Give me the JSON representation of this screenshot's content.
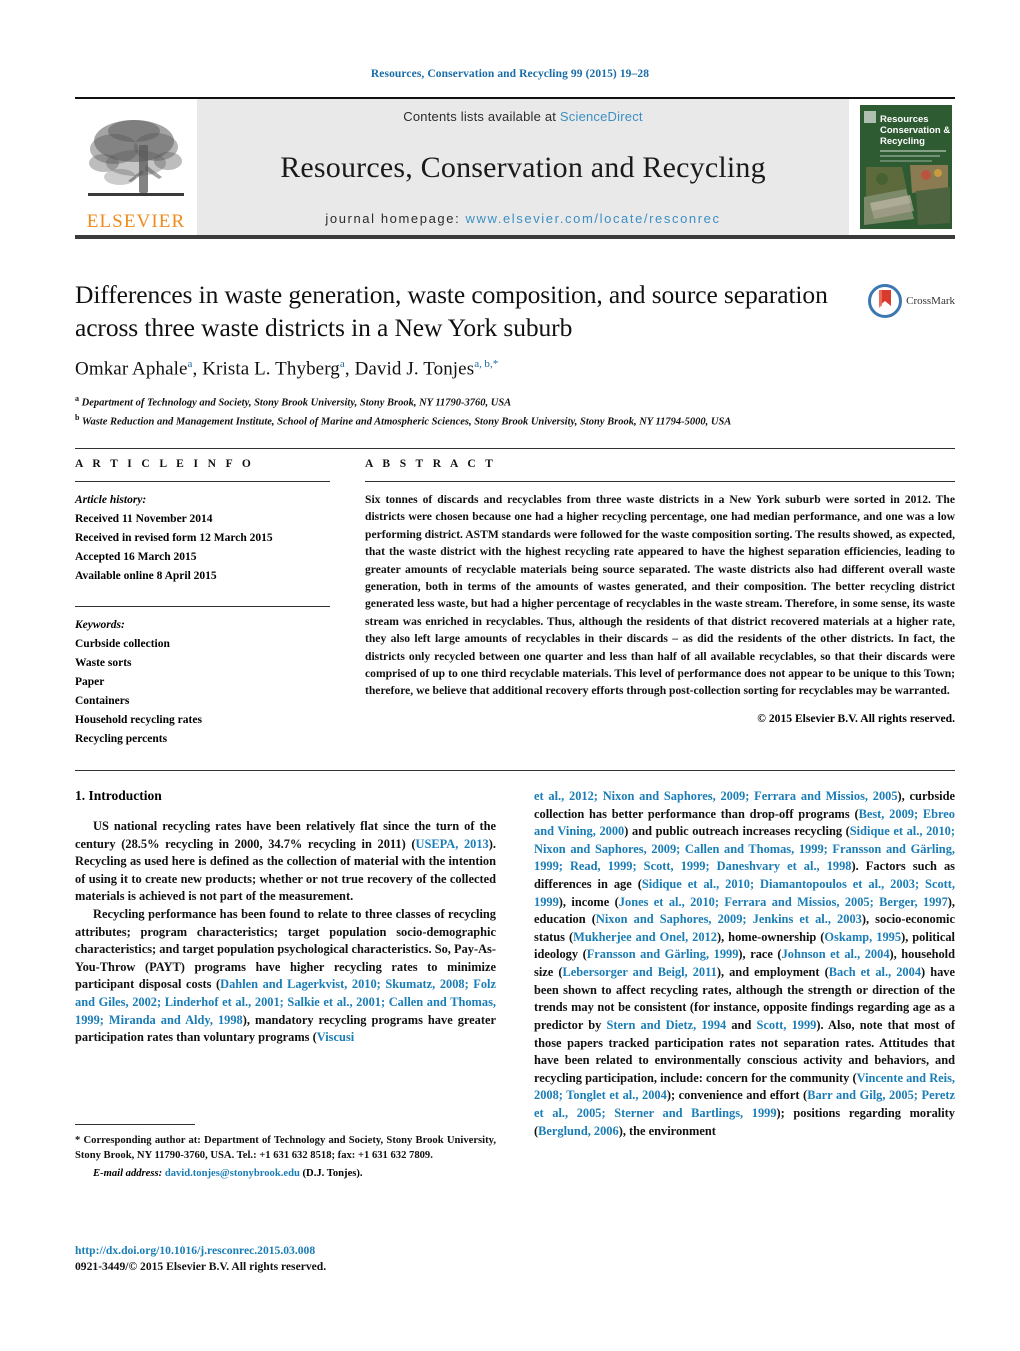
{
  "running_head": "Resources, Conservation and Recycling 99 (2015) 19–28",
  "masthead": {
    "publisher_logo_text": "ELSEVIER",
    "contents_prefix": "Contents lists available at",
    "contents_link": "ScienceDirect",
    "journal_name": "Resources, Conservation and Recycling",
    "homepage_prefix": "journal homepage:",
    "homepage_url": "www.elsevier.com/locate/resconrec",
    "cover_title_line1": "Resources",
    "cover_title_line2": "Conservation &",
    "cover_title_line3": "Recycling",
    "link_color": "#3d8fc4"
  },
  "article": {
    "title": "Differences in waste generation, waste composition, and source separation across three waste districts in a New York suburb",
    "authors_html": "Omkar Aphale<sup>a</sup>, Krista L. Thyberg<sup>a</sup>, David J. Tonjes<sup>a, b,</sup><sup>*</sup>",
    "affiliation_a": "Department of Technology and Society, Stony Brook University, Stony Brook, NY 11790-3760, USA",
    "affiliation_b": "Waste Reduction and Management Institute, School of Marine and Atmospheric Sciences, Stony Brook University, Stony Brook, NY 11794-5000, USA",
    "crossmark_label": "CrossMark"
  },
  "article_info": {
    "heading": "A R T I C L E   I N F O",
    "history_label": "Article history:",
    "history": [
      "Received 11 November 2014",
      "Received in revised form 12 March 2015",
      "Accepted 16 March 2015",
      "Available online 8 April 2015"
    ],
    "keywords_label": "Keywords:",
    "keywords": [
      "Curbside collection",
      "Waste sorts",
      "Paper",
      "Containers",
      "Household recycling rates",
      "Recycling percents"
    ]
  },
  "abstract": {
    "heading": "A B S T R A C T",
    "text": "Six tonnes of discards and recyclables from three waste districts in a New York suburb were sorted in 2012. The districts were chosen because one had a higher recycling percentage, one had median performance, and one was a low performing district. ASTM standards were followed for the waste composition sorting. The results showed, as expected, that the waste district with the highest recycling rate appeared to have the highest separation efficiencies, leading to greater amounts of recyclable materials being source separated. The waste districts also had different overall waste generation, both in terms of the amounts of wastes generated, and their composition. The better recycling district generated less waste, but had a higher percentage of recyclables in the waste stream. Therefore, in some sense, its waste stream was enriched in recyclables. Thus, although the residents of that district recovered materials at a higher rate, they also left large amounts of recyclables in their discards – as did the residents of the other districts. In fact, the districts only recycled between one quarter and less than half of all available recyclables, so that their discards were comprised of up to one third recyclable materials. This level of performance does not appear to be unique to this Town; therefore, we believe that additional recovery efforts through post-collection sorting for recyclables may be warranted.",
    "copyright": "© 2015 Elsevier B.V. All rights reserved."
  },
  "introduction": {
    "heading": "1.  Introduction",
    "left_paragraphs": [
      {
        "segments": [
          {
            "t": "US national recycling rates have been relatively flat since the turn of the century (28.5% recycling in 2000, 34.7% recycling in 2011) (",
            "link": false
          },
          {
            "t": "USEPA, 2013",
            "link": true
          },
          {
            "t": "). Recycling as used here is defined as the collection of material with the intention of using it to create new products; whether or not true recovery of the collected materials is achieved is not part of the measurement.",
            "link": false
          }
        ]
      },
      {
        "segments": [
          {
            "t": "Recycling performance has been found to relate to three classes of recycling attributes; program characteristics; target population socio-demographic characteristics; and target population psychological characteristics. So, Pay-As-You-Throw (PAYT) programs have higher recycling rates to minimize participant disposal costs (",
            "link": false
          },
          {
            "t": "Dahlen and Lagerkvist, 2010; Skumatz, 2008; Folz and Giles, 2002; Linderhof et al., 2001; Salkie et al., 2001; Callen and Thomas, 1999; Miranda and Aldy, 1998",
            "link": true
          },
          {
            "t": "), mandatory recycling programs have greater participation rates than voluntary programs (",
            "link": false
          },
          {
            "t": "Viscusi",
            "link": true
          }
        ]
      }
    ],
    "right_paragraphs": [
      {
        "segments": [
          {
            "t": "et al., 2012; Nixon and Saphores, 2009; Ferrara and Missios, 2005",
            "link": true
          },
          {
            "t": "), curbside collection has better performance than drop-off programs (",
            "link": false
          },
          {
            "t": "Best, 2009; Ebreo and Vining, 2000",
            "link": true
          },
          {
            "t": ") and public outreach increases recycling (",
            "link": false
          },
          {
            "t": "Sidique et al., 2010; Nixon and Saphores, 2009; Callen and Thomas, 1999; Fransson and Gärling, 1999; Read, 1999; Scott, 1999; Daneshvary et al., 1998",
            "link": true
          },
          {
            "t": "). Factors such as differences in age (",
            "link": false
          },
          {
            "t": "Sidique et al., 2010; Diamantopoulos et al., 2003; Scott, 1999",
            "link": true
          },
          {
            "t": "), income (",
            "link": false
          },
          {
            "t": "Jones et al., 2010; Ferrara and Missios, 2005; Berger, 1997",
            "link": true
          },
          {
            "t": "), education (",
            "link": false
          },
          {
            "t": "Nixon and Saphores, 2009; Jenkins et al., 2003",
            "link": true
          },
          {
            "t": "), socio-economic status (",
            "link": false
          },
          {
            "t": "Mukherjee and Onel, 2012",
            "link": true
          },
          {
            "t": "), home-ownership (",
            "link": false
          },
          {
            "t": "Oskamp, 1995",
            "link": true
          },
          {
            "t": "), political ideology (",
            "link": false
          },
          {
            "t": "Fransson and Gärling, 1999",
            "link": true
          },
          {
            "t": "), race (",
            "link": false
          },
          {
            "t": "Johnson et al., 2004",
            "link": true
          },
          {
            "t": "), household size (",
            "link": false
          },
          {
            "t": "Lebersorger and Beigl, 2011",
            "link": true
          },
          {
            "t": "), and employment (",
            "link": false
          },
          {
            "t": "Bach et al., 2004",
            "link": true
          },
          {
            "t": ") have been shown to affect recycling rates, although the strength or direction of the trends may not be consistent (for instance, opposite findings regarding age as a predictor by ",
            "link": false
          },
          {
            "t": "Stern and Dietz, 1994",
            "link": true
          },
          {
            "t": " and ",
            "link": false
          },
          {
            "t": "Scott, 1999",
            "link": true
          },
          {
            "t": "). Also, note that most of those papers tracked participation rates not separation rates. Attitudes that have been related to environmentally conscious activity and behaviors, and recycling participation, include: concern for the community (",
            "link": false
          },
          {
            "t": "Vincente and Reis, 2008; Tonglet et al., 2004",
            "link": true
          },
          {
            "t": "); convenience and effort (",
            "link": false
          },
          {
            "t": "Barr and Gilg, 2005; Peretz et al., 2005; Sterner and Bartlings, 1999",
            "link": true
          },
          {
            "t": "); positions regarding morality (",
            "link": false
          },
          {
            "t": "Berglund, 2006",
            "link": true
          },
          {
            "t": "), the environment",
            "link": false
          }
        ]
      }
    ]
  },
  "footnotes": {
    "corresponding": "* Corresponding author at: Department of Technology and Society, Stony Brook University, Stony Brook, NY 11790-3760, USA. Tel.: +1 631 632 8518; fax: +1 631 632 7809.",
    "email_label": "E-mail address:",
    "email": "david.tonjes@stonybrook.edu",
    "email_suffix": "(D.J. Tonjes).",
    "doi": "http://dx.doi.org/10.1016/j.resconrec.2015.03.008",
    "issn": "0921-3449/© 2015 Elsevier B.V. All rights reserved."
  }
}
